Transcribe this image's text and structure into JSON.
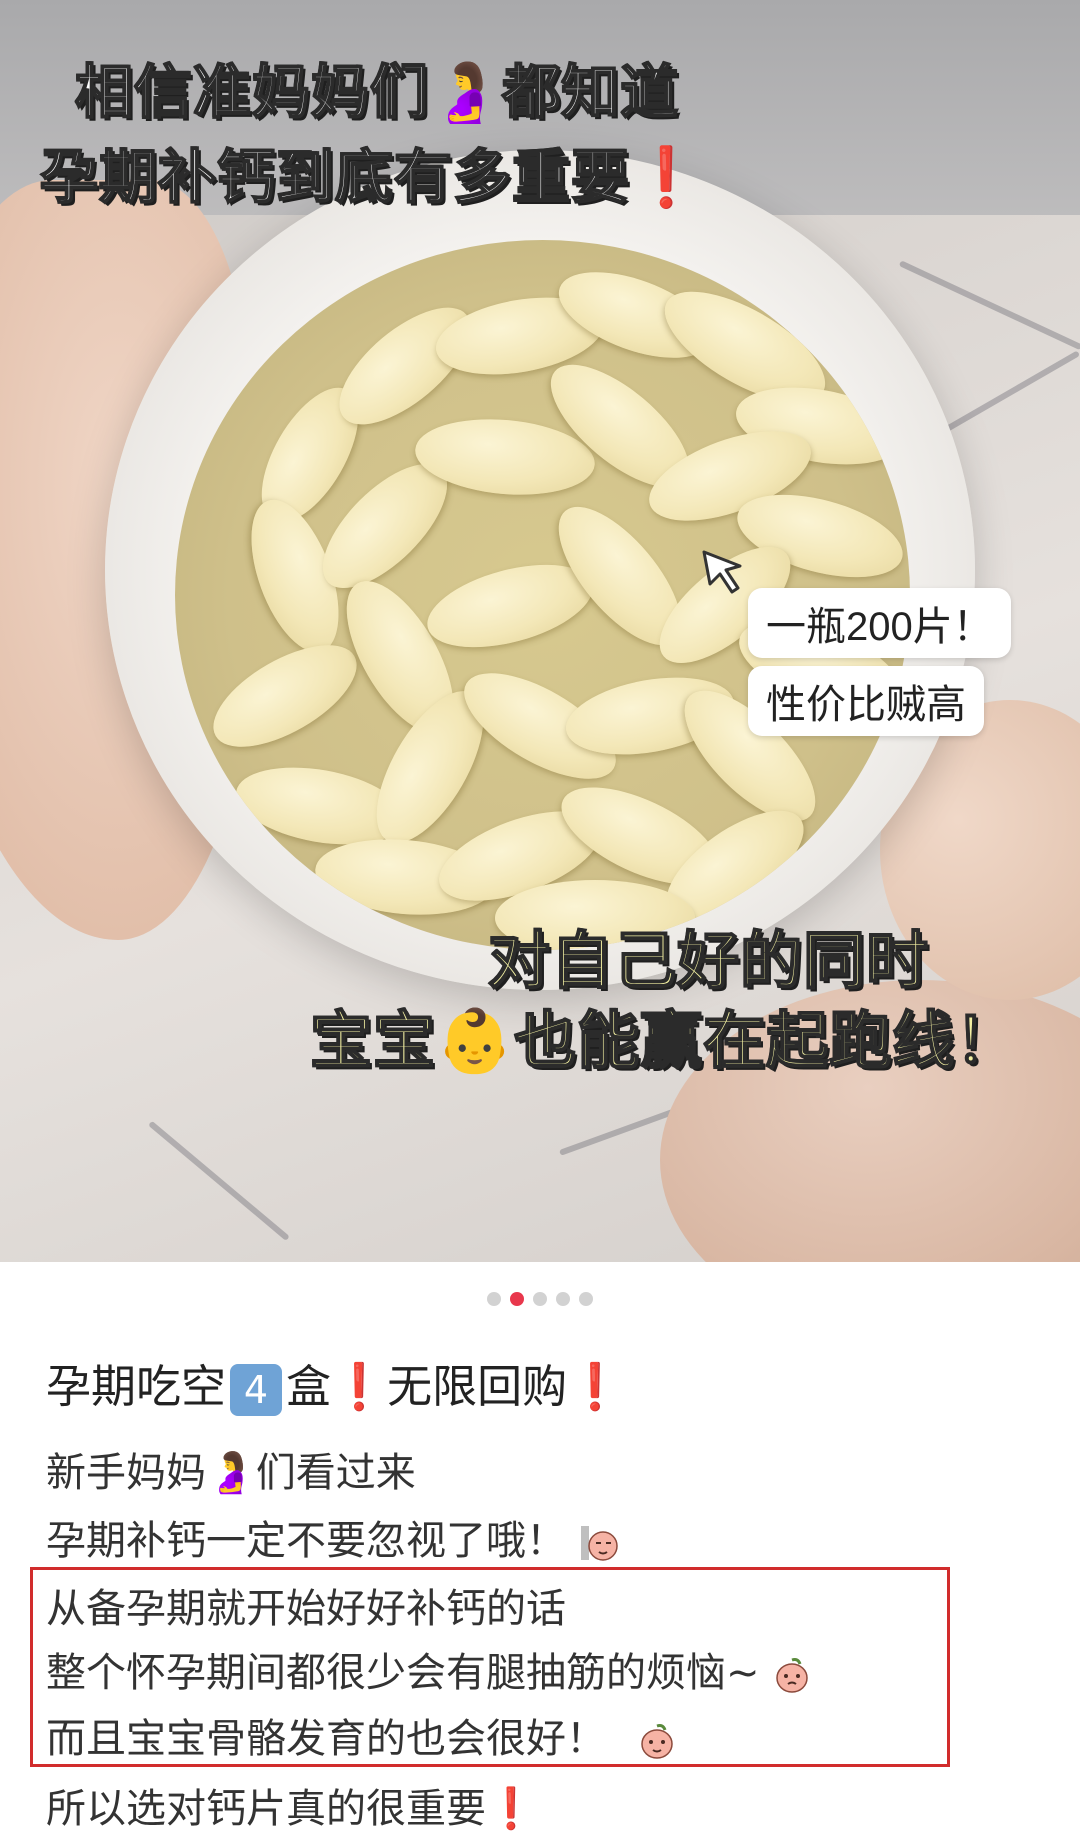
{
  "image_overlay": {
    "headline_line1_part1": "相信准妈妈们",
    "headline_line1_emoji": "🤰",
    "headline_line1_part2": "都知道",
    "headline_line2": "孕期补钙到底有多重要",
    "headline_line2_mark": "❗",
    "bubble1": "一瓶200片！",
    "bubble2": "性价比贼高",
    "bottom_line1": "对自己好的同时",
    "bottom_line2_part1": "宝宝",
    "bottom_line2_emoji": "👶",
    "bottom_line2_part2": "也能赢在起跑线！"
  },
  "carousel": {
    "total": 5,
    "active_index": 1
  },
  "post": {
    "title_part1": "孕期吃空",
    "title_keycap": "4",
    "title_part2": "盒",
    "title_excl1": "❗",
    "title_part3": "无限回购",
    "title_excl2": "❗",
    "line1_part1": "新手妈妈",
    "line1_emoji": "🤰",
    "line1_part2": "们看过来",
    "line2": "孕期补钙一定不要忽视了哦！",
    "line3": "从备孕期就开始好好补钙的话",
    "line4": "整个怀孕期间都很少会有腿抽筋的烦恼~",
    "line5": "而且宝宝骨骼发育的也会很好！",
    "line6": "所以选对钙片真的很重要",
    "line6_excl": "❗"
  },
  "colors": {
    "accent_red": "#e8262c",
    "dot_active": "#e8374c",
    "highlight_border": "#d12c2c",
    "headline_yellow": "#f3f0a2"
  }
}
